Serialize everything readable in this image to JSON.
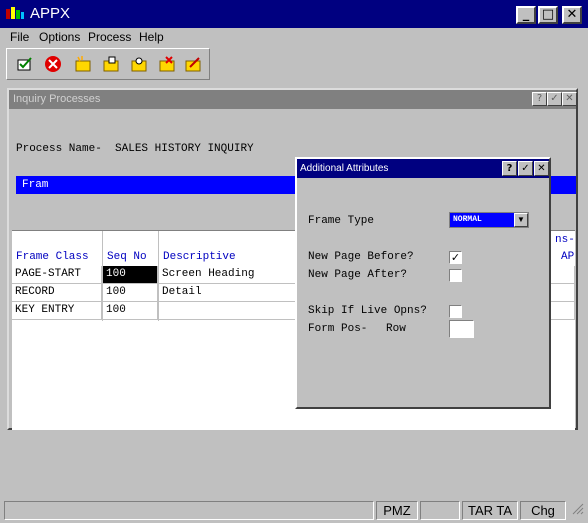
{
  "window": {
    "title": "APPX"
  },
  "menu": {
    "items": [
      "File",
      "Options",
      "Process",
      "Help"
    ]
  },
  "toolbar": {
    "icons": [
      "check-icon",
      "cancel-icon",
      "new-icon",
      "open-icon",
      "find-icon",
      "delete-icon",
      "edit-icon"
    ]
  },
  "inquiry": {
    "title": "Inquiry Processes",
    "process_name_label": "Process Name-",
    "process_name_value": "SALES HISTORY INQUIRY",
    "frame_bar_label": "Fram",
    "columns": [
      "Frame Class",
      "Seq No",
      "Descriptive"
    ],
    "extra_headers": [
      "ns-",
      "AP"
    ],
    "rows": [
      {
        "frame_class": "PAGE-START",
        "seq_no": "100",
        "descriptive": "Screen Heading"
      },
      {
        "frame_class": "RECORD",
        "seq_no": "100",
        "descriptive": "Detail"
      },
      {
        "frame_class": "KEY ENTRY",
        "seq_no": "100",
        "descriptive": ""
      }
    ]
  },
  "dialog": {
    "title": "Additional Attributes",
    "frame_type_label": "Frame Type",
    "frame_type_value": "NORMAL",
    "new_page_before_label": "New Page Before?",
    "new_page_before_checked": true,
    "new_page_after_label": "New Page After?",
    "new_page_after_checked": false,
    "skip_label": "Skip If Live Opns?",
    "skip_checked": false,
    "form_pos_label": "Form Pos-",
    "row_label": "Row",
    "row_value": ""
  },
  "statusbar": {
    "fields": [
      "PMZ",
      "TAR TA",
      "Chg"
    ]
  }
}
